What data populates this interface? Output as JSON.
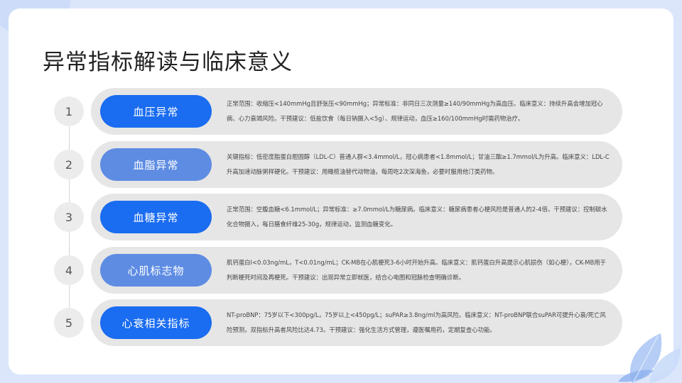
{
  "title": "异常指标解读与临床意义",
  "items": [
    {
      "number": "1",
      "label": "血压异常",
      "description": "正常范围：收缩压<140mmHg且舒张压<90mmHg；异常标准：非同日三次测量≥140/90mmHg为高血压。临床意义：持续升高会增加冠心病、心力衰竭风险。干预建议：低盐饮食（每日钠摄入<5g）、规律运动，血压≥160/100mmHg时需药物治疗。"
    },
    {
      "number": "2",
      "label": "血脂异常",
      "description": "关键指标：低密度脂蛋白胆固醇（LDL-C）普通人群<3.4mmol/L，冠心病患者<1.8mmol/L；甘油三酯≥1.7mmol/L为升高。临床意义：LDL-C升高加速动脉粥样硬化。干预建议：用橄榄油替代动物油，每周吃2次深海鱼，必要时服用他汀类药物。"
    },
    {
      "number": "3",
      "label": "血糖异常",
      "description": "正常范围：空腹血糖<6.1mmol/L；异常标准：≥7.0mmol/L为糖尿病。临床意义：糖尿病患者心梗风险是普通人的2-4倍。干预建议：控制碳水化合物摄入，每日膳食纤维25-30g，规律运动，监测血糖变化。"
    },
    {
      "number": "4",
      "label": "心肌标志物",
      "description": "肌钙蛋白I<0.03ng/mL，T<0.01ng/mL；CK-MB在心肌梗死3-6小时开始升高。临床意义：肌钙蛋白升高提示心肌损伤（如心梗），CK-MB用于判断梗死时间及再梗死。干预建议：出现异常立即就医，结合心电图和冠脉检查明确诊断。"
    },
    {
      "number": "5",
      "label": "心衰相关指标",
      "description": "NT-proBNP：75岁以下<300pg/L，75岁以上<450pg/L；suPAR≥3.8ng/ml为高风险。临床意义：NT-proBNP联合suPAR可提升心衰/死亡风险预测，双指标升高者风险比达4.73。干预建议：强化生活方式管理，遵医嘱用药，定期复查心功能。"
    }
  ],
  "colors": {
    "label_dark": "#1a6cf0",
    "label_light": "#5e8ce3",
    "pill_bg": "#e6e6e6"
  }
}
